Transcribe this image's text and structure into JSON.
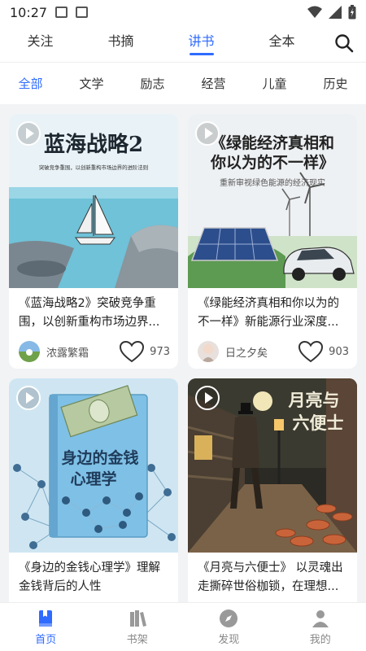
{
  "status": {
    "time": "10:27"
  },
  "top_tabs": [
    {
      "label": "关注"
    },
    {
      "label": "书摘"
    },
    {
      "label": "讲书"
    },
    {
      "label": "全本"
    }
  ],
  "categories": [
    {
      "label": "全部"
    },
    {
      "label": "文学"
    },
    {
      "label": "励志"
    },
    {
      "label": "经营"
    },
    {
      "label": "儿童"
    },
    {
      "label": "历史"
    }
  ],
  "cards": [
    {
      "cover_title": "蓝海战略2",
      "cover_subtitle": "突破竞争重围，以创新重构市场边界的进阶法则",
      "title": "《蓝海战略2》突破竞争重围，以创新重构市场边界...",
      "author": "浓露繁霜",
      "likes": "973"
    },
    {
      "cover_title_line1": "《绿能经济真相和",
      "cover_title_line2": "你以为的不一样》",
      "cover_subtitle": "重新审视绿色能源的经济现实",
      "title": "《绿能经济真相和你以为的不一样》新能源行业深度...",
      "author": "日之夕矣",
      "likes": "903"
    },
    {
      "cover_title_line1": "身边的金钱",
      "cover_title_line2": "心理学",
      "title": "《身边的金钱心理学》理解金钱背后的人性",
      "author": "",
      "likes": ""
    },
    {
      "cover_title_line1": "月亮与",
      "cover_title_line2": "六便士",
      "title": "《月亮与六便士》 以灵魂出走撕碎世俗枷锁，在理想...",
      "author": "",
      "likes": ""
    }
  ],
  "bottom_nav": [
    {
      "label": "首页"
    },
    {
      "label": "书架"
    },
    {
      "label": "发现"
    },
    {
      "label": "我的"
    }
  ],
  "colors": {
    "accent": "#2f6bff",
    "inactive": "#888888"
  }
}
